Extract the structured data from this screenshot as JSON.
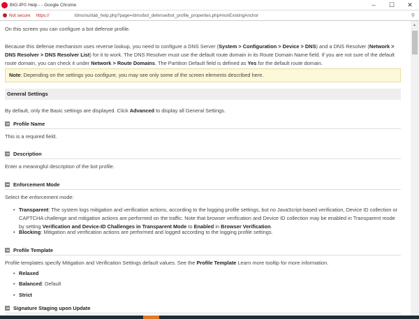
{
  "window": {
    "title": "BIG-IP© Help - - Google Chrome",
    "minimize": "–",
    "maximize": "☐",
    "close": "✕"
  },
  "address": {
    "not_secure": "Not secure",
    "scheme": "https://",
    "path": "/dms/xui/tab_help.php?page=/dms/bot_defense/bot_profile_properties.php#nonExistingAnchor",
    "zoom_icon": "🔍"
  },
  "content": {
    "intro": [
      {
        "t": "On this screen you can configure a bot defense profile."
      }
    ],
    "dns": [
      {
        "t": "Because this defense mechanism uses reverse lookup, you need to configure a DNS Server ("
      },
      {
        "t": "System > Configuration > Device > DNS",
        "b": 1
      },
      {
        "t": ") and a DNS Resolver ("
      },
      {
        "t": "Network > DNS Resolver > DNS Resolver List",
        "b": 1
      },
      {
        "t": ") for it to work. The DNS Resolver must use the default route domain in its Route Domain Name field. If you are not sure of the default route domain, you can check it under "
      },
      {
        "t": "Network > Route Domains",
        "b": 1
      },
      {
        "t": ". The Partition Default field is defined as "
      },
      {
        "t": "Yes",
        "b": 1
      },
      {
        "t": " for the default route domain."
      }
    ],
    "note": [
      {
        "t": "Note",
        "b": 1
      },
      {
        "t": ": Depending on the settings you configure, you may see only some of the screen elements described here."
      }
    ],
    "general_settings": "General Settings",
    "general_text": [
      {
        "t": "By default, only the Basic settings are displayed. Click "
      },
      {
        "t": "Advanced",
        "b": 1
      },
      {
        "t": " to display all General Settings."
      }
    ],
    "profile_name": "Profile Name",
    "profile_name_text": [
      {
        "t": "This is a required field."
      }
    ],
    "description": "Description",
    "description_text": [
      {
        "t": "Enter a meaningful description of the bot profile."
      }
    ],
    "enforcement": "Enforcement Mode",
    "enforcement_text": [
      {
        "t": "Select the enforcement mode:"
      }
    ],
    "transparent": [
      {
        "t": "Transparent",
        "b": 1
      },
      {
        "t": ": The system logs mitigation and verification actions, according to the logging profile settings, but no JavaScript-based verification, Device ID collection or CAPTCHA challenge and mitigation actions are performed on the traffic. Note that browser verification and Device ID collection may be enabled in Transparent mode by setting "
      },
      {
        "t": "Verification and Device-ID Challenges in Transparent Mode",
        "b": 1
      },
      {
        "t": " to "
      },
      {
        "t": "Enabled",
        "b": 1
      },
      {
        "t": " in "
      },
      {
        "t": "Browser Verification",
        "b": 1
      },
      {
        "t": "."
      }
    ],
    "blocking": [
      {
        "t": "Blocking",
        "b": 1
      },
      {
        "t": ": Mitigation and verification actions are performed and logged according to the logging profile settings."
      }
    ],
    "profile_template": "Profile Template",
    "template_text": [
      {
        "t": "Profile templates specify Mitigation and Verification Settings default values. See the "
      },
      {
        "t": "Profile Template",
        "b": 1
      },
      {
        "t": " Learn more tooltip for more information."
      }
    ],
    "relaxed": [
      {
        "t": "Relaxed",
        "b": 1
      }
    ],
    "balanced": [
      {
        "t": "Balanced",
        "b": 1
      },
      {
        "t": ": Default"
      }
    ],
    "strict": [
      {
        "t": "Strict",
        "b": 1
      }
    ],
    "signature_staging": "Signature Staging upon Update"
  }
}
